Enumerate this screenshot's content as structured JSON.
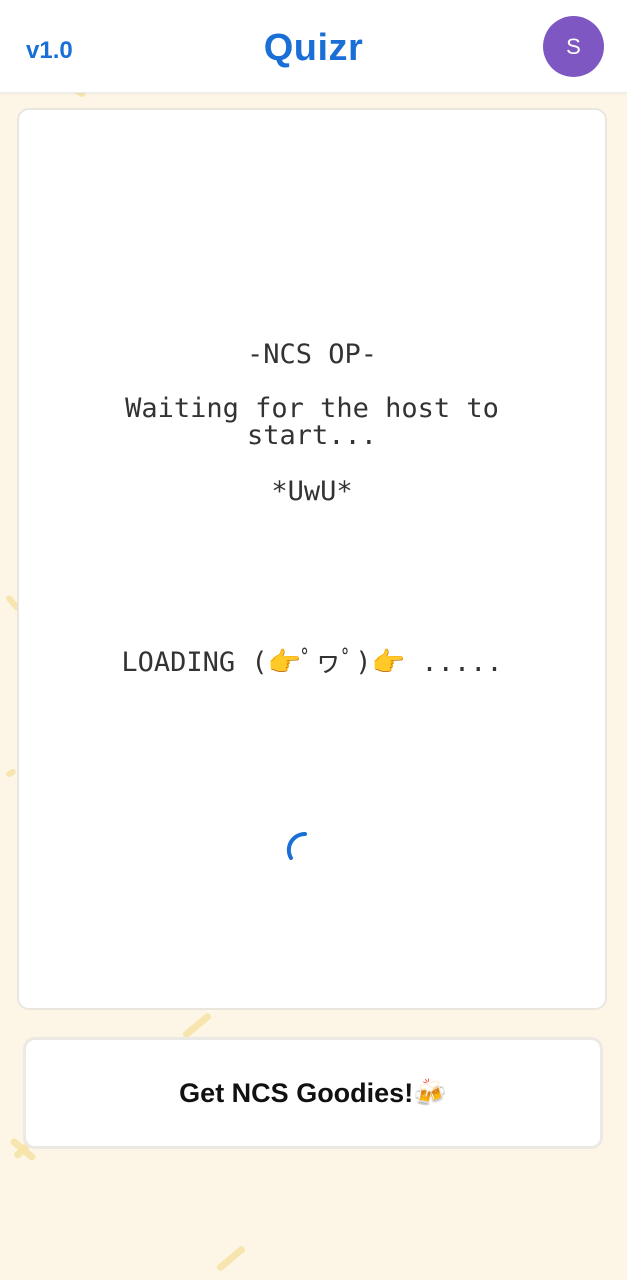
{
  "header": {
    "version": "v1.0",
    "title": "Quizr",
    "avatar_initial": "S"
  },
  "lobby": {
    "quiz_name": "-NCS OP-",
    "status": "Waiting for the host to start...",
    "emote": "*UwU*",
    "loading_text": "LOADING (👉ﾟヮﾟ)👉 ....."
  },
  "spinner": {
    "icon": "loading-spinner-icon",
    "color": "#1a6fd6"
  },
  "goodies_button": {
    "label": "Get NCS Goodies!🍻"
  },
  "colors": {
    "accent": "#1a6fd6",
    "avatar_bg": "#7e57c2",
    "background": "#fdf6e6",
    "decor": "#f6e3a8"
  }
}
